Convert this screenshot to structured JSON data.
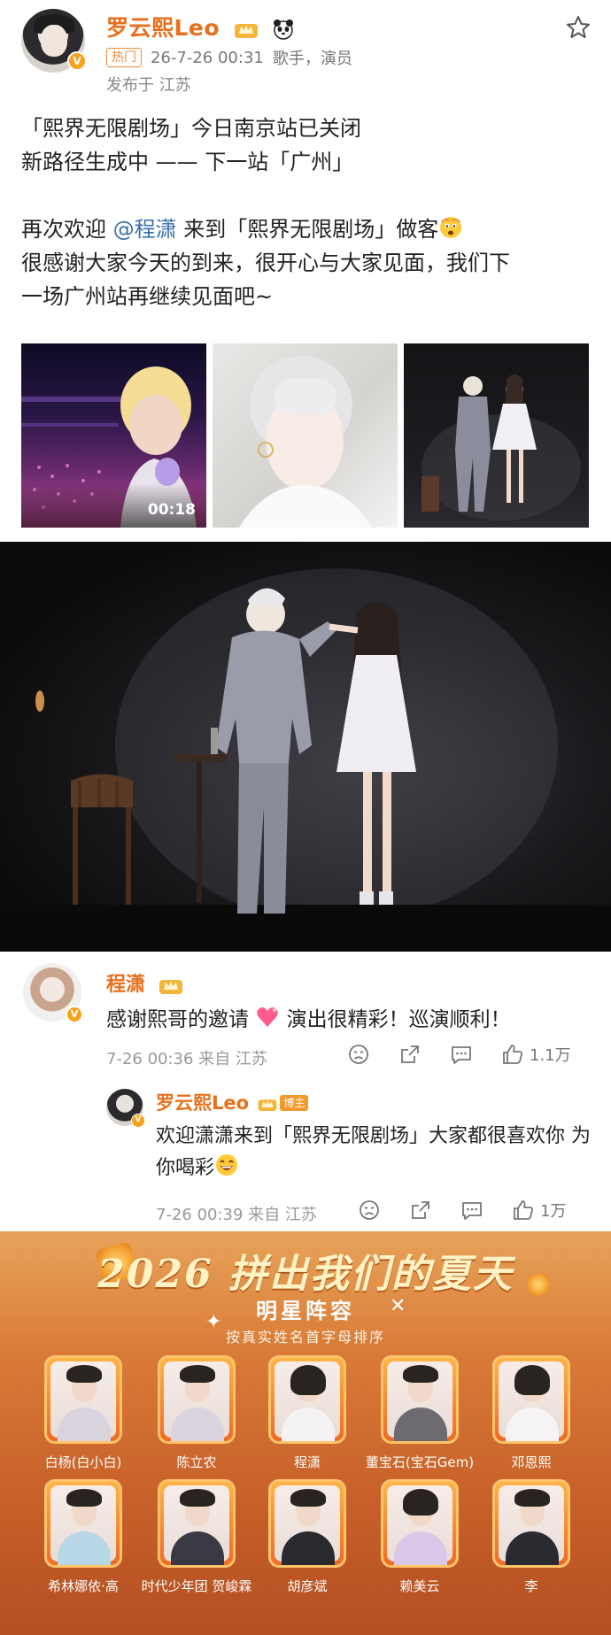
{
  "post": {
    "username": "罗云熙Leo",
    "hot_tag": "热门",
    "timestamp": "26-7-26 00:31",
    "profession": "歌手，演员",
    "location": "发布于 江苏",
    "text_line1": "「熙界无限剧场」今日南京站已关闭",
    "text_line2": "新路径生成中 —— 下一站「广州」",
    "text_line3_prefix": "再次欢迎 ",
    "text_line3_mention": "@程潇",
    "text_line3_suffix": " 来到「熙界无限剧场」做客",
    "text_line4": "很感谢大家今天的到来，很开心与大家见面，我们下",
    "text_line5": "一场广州站再继续见面吧~",
    "video_duration": "00:18"
  },
  "comments": [
    {
      "name": "程潇",
      "text_prefix": "感谢熙哥的邀请 ",
      "text_suffix": " 演出很精彩！巡演顺利！",
      "meta": "7-26 00:36  来自 江苏",
      "likes": "1.1万"
    },
    {
      "name": "罗云熙Leo",
      "host_tag": "博主",
      "text": "欢迎潇潇来到「熙界无限剧场」大家都很喜欢你 为你喝彩",
      "meta": "7-26 00:39  来自 江苏",
      "likes": "1万"
    }
  ],
  "banner": {
    "title": "2026 拼出我们的夏天",
    "subtitle": "明星阵容",
    "note": "按真实姓名首字母排序",
    "row1": [
      "白杨(白小白)",
      "陈立农",
      "程潇",
      "董宝石(宝石Gem)",
      "邓恩熙"
    ],
    "row2": [
      "希林娜依·高",
      "时代少年团 贺峻霖",
      "胡彦斌",
      "赖美云",
      "李"
    ]
  },
  "icons": {
    "star": "star-outline-icon",
    "dislike": "thumbs-down-face-icon",
    "share": "share-icon",
    "comment": "comment-icon",
    "like": "thumbs-up-icon"
  },
  "colors": {
    "username": "#e8701c",
    "mention": "#3a6fb0",
    "banner": "#d97b37"
  }
}
